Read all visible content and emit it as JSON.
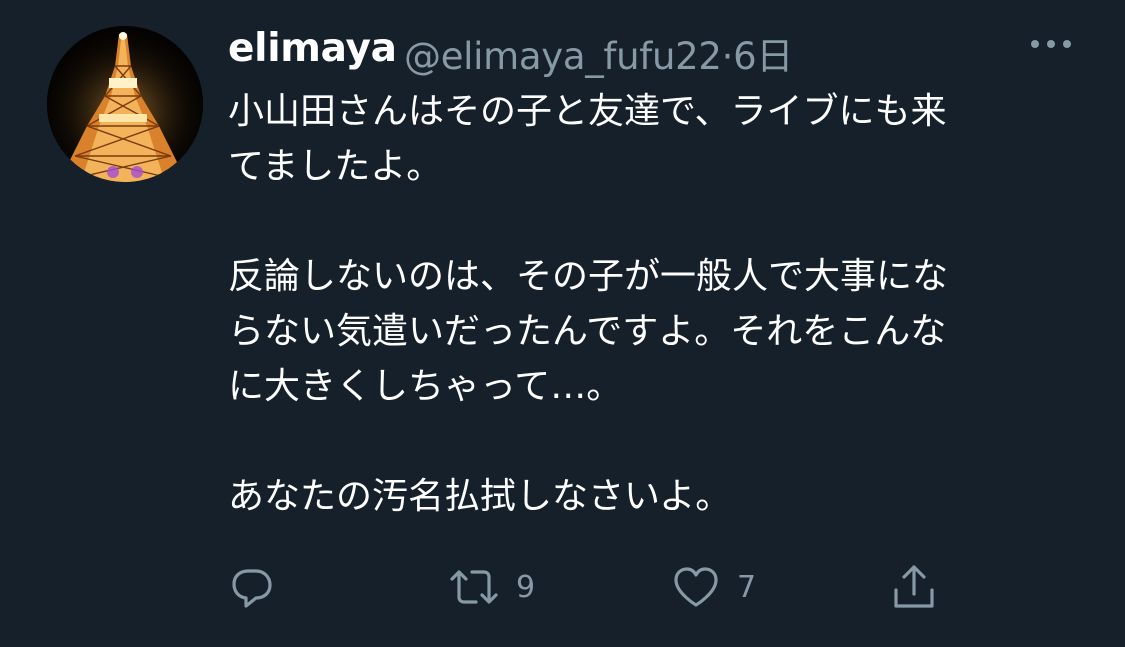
{
  "tweet": {
    "display_name": "elimaya",
    "handle": "@elimaya_fufu22",
    "separator": "·",
    "time": "6日",
    "body_lines": [
      "小山田さんはその子と友達で、ライブにも来",
      "てましたよ。",
      "",
      "反論しないのは、その子が一般人で大事にな",
      "らない気遣いだったんですよ。それをこんな",
      "に大きくしちゃって…。",
      "",
      "あなたの汚名払拭しなさいよ。"
    ]
  },
  "actions": {
    "reply": {
      "icon": "reply-icon",
      "count": ""
    },
    "retweet": {
      "icon": "retweet-icon",
      "count": "9"
    },
    "like": {
      "icon": "heart-icon",
      "count": "7"
    },
    "share": {
      "icon": "share-icon",
      "count": ""
    }
  },
  "colors": {
    "background": "#15202b",
    "text_primary": "#ffffff",
    "text_secondary": "#8899a6",
    "icon": "#8899a6"
  }
}
